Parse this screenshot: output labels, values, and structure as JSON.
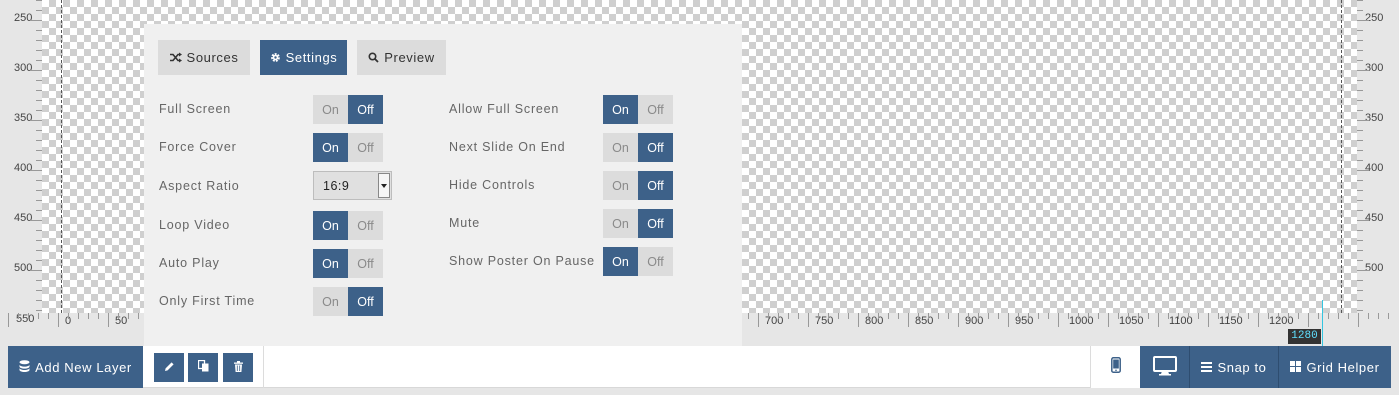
{
  "rulers": {
    "vertical_labels": [
      "250",
      "300",
      "350",
      "400",
      "450",
      "500",
      "550"
    ],
    "horizontal_labels": [
      "0",
      "50",
      "700",
      "750",
      "800",
      "850",
      "900",
      "950",
      "1000",
      "1050",
      "1100",
      "1150",
      "1200"
    ],
    "width_marker": "1280"
  },
  "panel": {
    "tabs": [
      {
        "label": "Sources",
        "icon": "shuffle-icon",
        "active": false
      },
      {
        "label": "Settings",
        "icon": "gear-icon",
        "active": true
      },
      {
        "label": "Preview",
        "icon": "search-icon",
        "active": false
      }
    ],
    "toggle_on_label": "On",
    "toggle_off_label": "Off",
    "left_column": [
      {
        "label": "Full Screen",
        "type": "toggle",
        "value": "Off"
      },
      {
        "label": "Force Cover",
        "type": "toggle",
        "value": "On"
      },
      {
        "label": "Aspect Ratio",
        "type": "select",
        "value": "16:9"
      },
      {
        "label": "Loop Video",
        "type": "toggle",
        "value": "On"
      },
      {
        "label": "Auto Play",
        "type": "toggle",
        "value": "On"
      },
      {
        "label": "Only First Time",
        "type": "toggle",
        "value": "Off"
      }
    ],
    "right_column": [
      {
        "label": "Allow Full Screen",
        "type": "toggle",
        "value": "On"
      },
      {
        "label": "Next Slide On End",
        "type": "toggle",
        "value": "Off"
      },
      {
        "label": "Hide Controls",
        "type": "toggle",
        "value": "Off"
      },
      {
        "label": "Mute",
        "type": "toggle",
        "value": "Off"
      },
      {
        "label": "Show Poster On Pause",
        "type": "toggle",
        "value": "On"
      }
    ]
  },
  "bottombar": {
    "add_layer_label": "Add New Layer",
    "snap_label": "Snap to",
    "grid_label": "Grid Helper",
    "icons": {
      "add_layer": "layers-icon",
      "edit": "pencil-icon",
      "duplicate": "copy-icon",
      "delete": "trash-icon",
      "mobile": "mobile-icon",
      "desktop": "desktop-icon",
      "snap": "lines-icon",
      "grid": "grid-icon"
    }
  },
  "colors": {
    "accent": "#3d6189",
    "marker": "#34c5e0",
    "panel_bg": "#f0f0f0"
  }
}
